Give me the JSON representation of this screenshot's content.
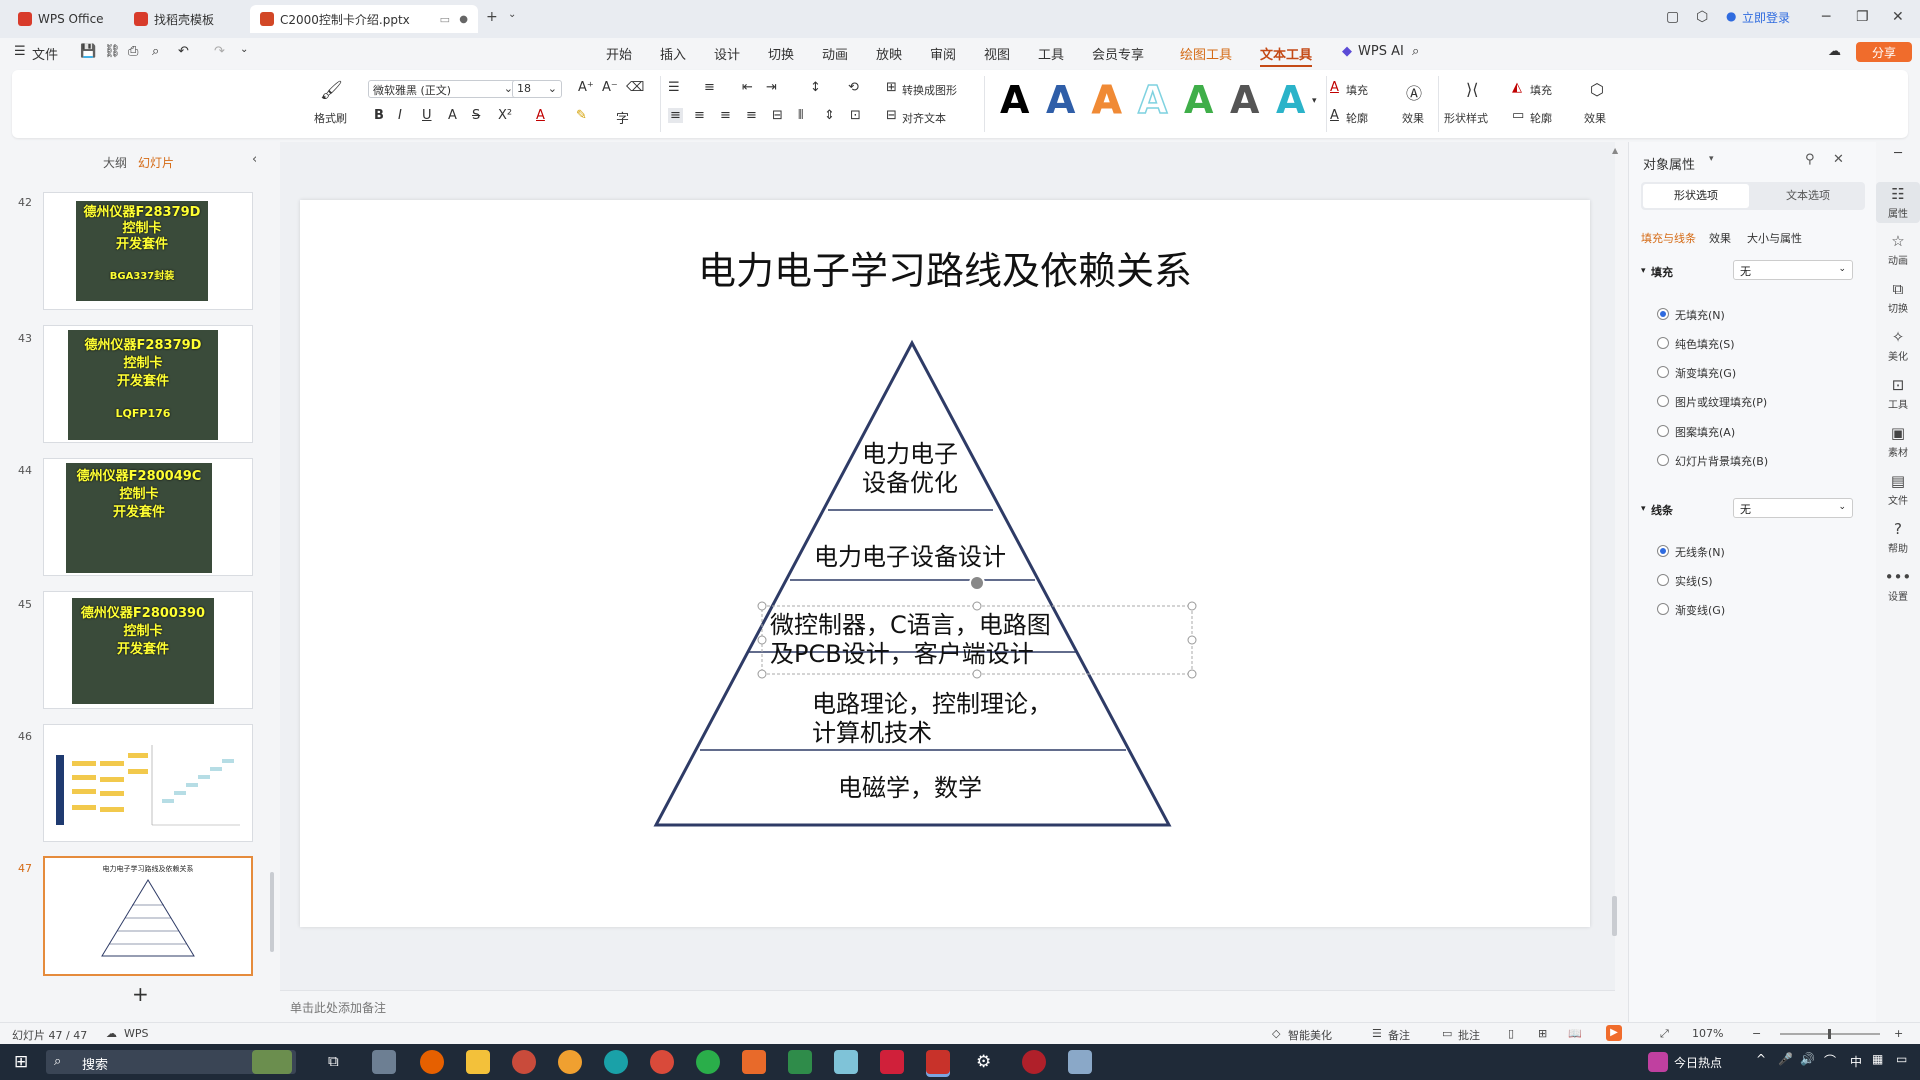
{
  "tabs": [
    {
      "label": "WPS Office",
      "color": "#d83b2b"
    },
    {
      "label": "找稻壳模板",
      "color": "#d83b2b"
    },
    {
      "label": "C2000控制卡介绍.pptx",
      "color": "#d24726"
    }
  ],
  "header": {
    "login": "立即登录"
  },
  "menubar": {
    "file": "文件",
    "items": [
      "开始",
      "插入",
      "设计",
      "切换",
      "动画",
      "放映",
      "审阅",
      "视图",
      "工具",
      "会员专享"
    ],
    "drawing_tools": "绘图工具",
    "text_tools": "文本工具",
    "wps_ai": "WPS AI",
    "share": "分享"
  },
  "ribbon": {
    "format_painter": "格式刷",
    "font_name": "微软雅黑 (正文)",
    "font_size": "18",
    "convert_shape": "转换成图形",
    "align_text": "对齐文本",
    "fill": "填充",
    "outline": "轮廓",
    "effects": "效果",
    "shape_style": "形状样式",
    "shape_fill": "填充",
    "shape_outline": "轮廓",
    "shape_effects": "效果",
    "wordart_glyph": "A",
    "wordart_colors": [
      "#000000",
      "#2f5ea8",
      "#f08a35",
      "#7fd2e0",
      "#3fae49",
      "#555555",
      "#2bb3c9"
    ]
  },
  "leftpanel": {
    "tab_outline": "大纲",
    "tab_slides": "幻灯片",
    "slides": [
      {
        "num": "42",
        "lines": [
          "德州仪器F28379D",
          "控制卡",
          "开发套件"
        ],
        "sub": "BGA337封装"
      },
      {
        "num": "43",
        "lines": [
          "德州仪器F28379D",
          "控制卡",
          "开发套件"
        ],
        "sub": "LQFP176"
      },
      {
        "num": "44",
        "lines": [
          "德州仪器F280049C",
          "控制卡",
          "开发套件"
        ],
        "sub": ""
      },
      {
        "num": "45",
        "lines": [
          "德州仪器F2800390",
          "控制卡",
          "开发套件"
        ],
        "sub": ""
      },
      {
        "num": "46",
        "lines": [],
        "sub": ""
      },
      {
        "num": "47",
        "lines": [],
        "sub": ""
      }
    ],
    "thumb47_title": "电力电子学习路线及依赖关系",
    "add_symbol": "+"
  },
  "slide": {
    "title": "电力电子学习路线及依赖关系",
    "levels": [
      [
        "电力电子",
        "设备优化"
      ],
      [
        "电力电子设备设计"
      ],
      [
        "微控制器，C语言，电路图",
        "及PCB设计，客户端设计"
      ],
      [
        "电路理论，控制理论，",
        "计算机技术"
      ],
      [
        "电磁学，数学"
      ]
    ]
  },
  "notes": {
    "placeholder": "单击此处添加备注"
  },
  "rightpanel": {
    "title": "对象属性",
    "tab_shape": "形状选项",
    "tab_text": "文本选项",
    "subtabs": [
      "填充与线条",
      "效果",
      "大小与属性"
    ],
    "fill_label": "填充",
    "fill_value": "无",
    "fill_options": [
      "无填充(N)",
      "纯色填充(S)",
      "渐变填充(G)",
      "图片或纹理填充(P)",
      "图案填充(A)",
      "幻灯片背景填充(B)"
    ],
    "line_label": "线条",
    "line_value": "无",
    "line_options": [
      "无线条(N)",
      "实线(S)",
      "渐变线(G)"
    ]
  },
  "sidebar_right": [
    "属性",
    "动画",
    "切换",
    "美化",
    "工具",
    "素材",
    "文件",
    "帮助",
    "设置"
  ],
  "status": {
    "slide_count": "幻灯片 47 / 47",
    "wps": "WPS",
    "smart_beautify": "智能美化",
    "notes": "备注",
    "comments": "批注",
    "zoom": "107%"
  },
  "taskbar": {
    "search": "搜索",
    "news": "今日热点",
    "ime": "中"
  }
}
